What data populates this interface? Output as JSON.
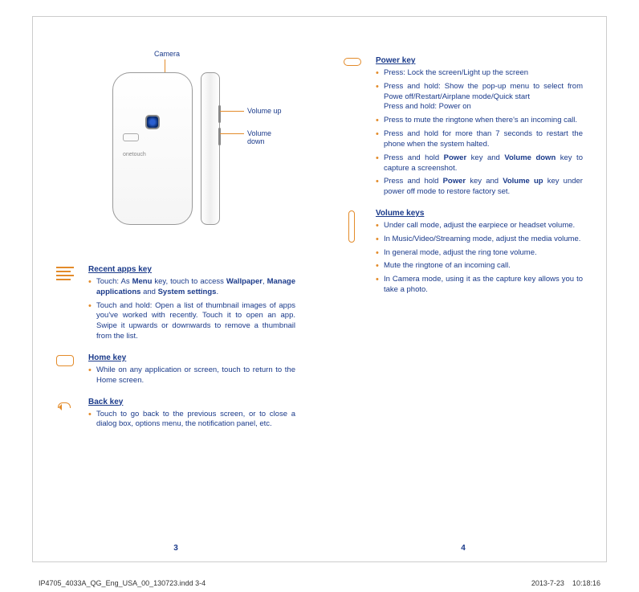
{
  "diagram": {
    "camera_label": "Camera",
    "brand": "onetouch",
    "volume_up": "Volume up",
    "volume_down": "Volume down"
  },
  "left": {
    "recent": {
      "title": "Recent apps key",
      "b1_pre": "Touch:  As ",
      "b1_bold1": "Menu",
      "b1_mid1": " key, touch to access ",
      "b1_bold2": "Wallpaper",
      "b1_mid2": ", ",
      "b1_bold3": "Manage applications",
      "b1_mid3": " and ",
      "b1_bold4": "System settings",
      "b1_end": ".",
      "b2": "Touch and hold: Open a list of thumbnail images of apps you've worked with recently. Touch it to open an app. Swipe it upwards or downwards to remove a thumbnail from the list."
    },
    "home": {
      "title": "Home key",
      "b1": "While on any application or screen,  touch to return to the Home screen."
    },
    "back": {
      "title": "Back key",
      "b1": "Touch to go back to the previous screen, or to close a dialog box, options menu, the notification panel, etc."
    }
  },
  "right": {
    "power": {
      "title": "Power key",
      "b1": "Press: Lock the screen/Light up the screen",
      "b2a": "Press and hold: Show the pop-up menu to select from Powe off/Restart/Airplane mode/Quick start",
      "b2b": "Press and hold: Power on",
      "b3": "Press to mute the ringtone when there's an incoming call.",
      "b4": "Press and hold for more than 7 seconds to restart the phone when the system halted.",
      "b5_pre": "Press and hold ",
      "b5_bold1": "Power",
      "b5_mid1": " key and ",
      "b5_bold2": "Volume down",
      "b5_end": " key to capture a screenshot.",
      "b6_pre": "Press and hold ",
      "b6_bold1": "Power",
      "b6_mid1": " key and ",
      "b6_bold2": "Volume up",
      "b6_end": " key under power off mode to restore factory set."
    },
    "volume": {
      "title": "Volume keys",
      "b1": "Under call mode, adjust the earpiece or headset volume.",
      "b2": "In Music/Video/Streaming mode, adjust the media volume.",
      "b3": "In general mode, adjust the ring tone volume.",
      "b4": "Mute the ringtone of an incoming call.",
      "b5": "In Camera mode, using it as the capture key allows you to take a photo."
    }
  },
  "page_left": "3",
  "page_right": "4",
  "footer": {
    "file": "IP4705_4033A_QG_Eng_USA_00_130723.indd   3-4",
    "date": "2013-7-23",
    "time": "10:18:16"
  }
}
